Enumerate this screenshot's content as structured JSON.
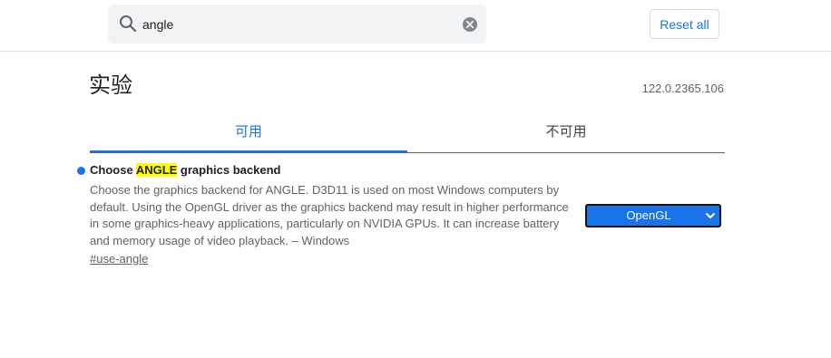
{
  "search": {
    "value": "angle",
    "placeholder": "Search flags"
  },
  "toolbar": {
    "reset_label": "Reset all"
  },
  "page": {
    "title": "实验",
    "version": "122.0.2365.106"
  },
  "tabs": [
    {
      "label": "可用",
      "active": true
    },
    {
      "label": "不可用",
      "active": false
    }
  ],
  "experiment": {
    "title_before": "Choose ",
    "title_highlight": "ANGLE",
    "title_after": " graphics backend",
    "description": "Choose the graphics backend for ANGLE. D3D11 is used on most Windows computers by default. Using the OpenGL driver as the graphics backend may result in higher performance in some graphics-heavy applications, particularly on NVIDIA GPUs. It can increase battery and memory usage of video playback. – Windows",
    "link": "#use-angle",
    "selected_option": "OpenGL"
  },
  "colors": {
    "accent": "#1a73e8",
    "highlight": "#ffff00",
    "text_secondary": "#5f6368"
  },
  "icons": {
    "search": "search-icon",
    "clear": "clear-icon",
    "dropdown": "chevron-down-icon",
    "status": "enabled-dot-icon"
  }
}
